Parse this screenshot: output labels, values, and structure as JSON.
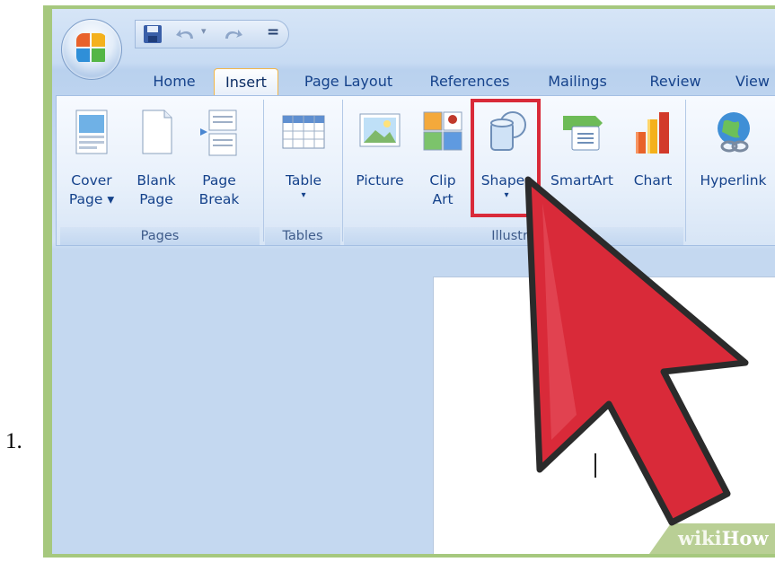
{
  "step_number": "1.",
  "quick_access": {
    "save_icon": "save-icon",
    "undo_icon": "undo-icon",
    "redo_icon": "redo-icon",
    "customize": "="
  },
  "tabs": [
    {
      "label": "Home",
      "active": false
    },
    {
      "label": "Insert",
      "active": true
    },
    {
      "label": "Page Layout",
      "active": false
    },
    {
      "label": "References",
      "active": false
    },
    {
      "label": "Mailings",
      "active": false
    },
    {
      "label": "Review",
      "active": false
    },
    {
      "label": "View",
      "active": false
    }
  ],
  "ribbon": {
    "groups": {
      "pages": "Pages",
      "tables": "Tables",
      "illustrations": "Illustra"
    },
    "buttons": {
      "cover_page": {
        "line1": "Cover",
        "line2": "Page ▾"
      },
      "blank_page": {
        "line1": "Blank",
        "line2": "Page"
      },
      "page_break": {
        "line1": "Page",
        "line2": "Break"
      },
      "table": {
        "line1": "Table",
        "arrow": "▾"
      },
      "picture": {
        "line1": "Picture"
      },
      "clip_art": {
        "line1": "Clip",
        "line2": "Art"
      },
      "shapes": {
        "line1": "Shapes",
        "arrow": "▾"
      },
      "smartart": {
        "line1": "SmartArt"
      },
      "chart": {
        "line1": "Chart"
      },
      "hyperlink": {
        "line1": "Hyperlink"
      }
    }
  },
  "watermark": {
    "prefix": "wiki",
    "suffix": "How"
  },
  "colors": {
    "highlight": "#d92a39",
    "cursor": "#d92a39",
    "tab_text": "#15428b",
    "frame": "#a6c87e"
  }
}
